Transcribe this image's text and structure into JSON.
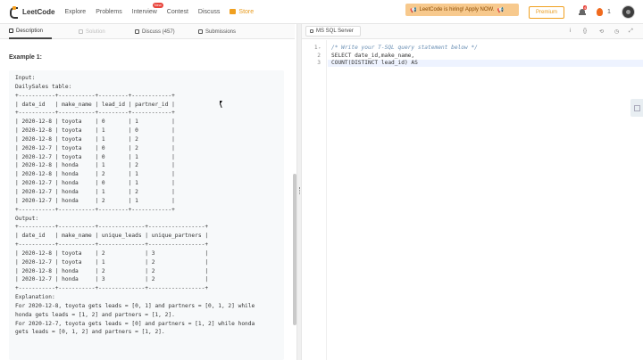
{
  "nav": {
    "logo": "LeetCode",
    "links": [
      "Explore",
      "Problems",
      "Interview",
      "Contest",
      "Discuss"
    ],
    "interview_badge": "New",
    "store": "Store",
    "hiring": "LeetCode is hiring! Apply NOW.",
    "premium": "Premium",
    "notifications": "4",
    "streak": "1"
  },
  "left_tabs": {
    "description": "Description",
    "solution": "Solution",
    "discuss": "Discuss (457)",
    "submissions": "Submissions"
  },
  "description": {
    "example_title": "Example 1:",
    "example_text": "Input:\nDailySales table:\n+-----------+-----------+---------+------------+\n| date_id   | make_name | lead_id | partner_id |\n+-----------+-----------+---------+------------+\n| 2020-12-8 | toyota    | 0       | 1          |\n| 2020-12-8 | toyota    | 1       | 0          |\n| 2020-12-8 | toyota    | 1       | 2          |\n| 2020-12-7 | toyota    | 0       | 2          |\n| 2020-12-7 | toyota    | 0       | 1          |\n| 2020-12-8 | honda     | 1       | 2          |\n| 2020-12-8 | honda     | 2       | 1          |\n| 2020-12-7 | honda     | 0       | 1          |\n| 2020-12-7 | honda     | 1       | 2          |\n| 2020-12-7 | honda     | 2       | 1          |\n+-----------+-----------+---------+------------+\nOutput:\n+-----------+-----------+--------------+-----------------+\n| date_id   | make_name | unique_leads | unique_partners |\n+-----------+-----------+--------------+-----------------+\n| 2020-12-8 | toyota    | 2            | 3               |\n| 2020-12-7 | toyota    | 1            | 2               |\n| 2020-12-8 | honda     | 2            | 2               |\n| 2020-12-7 | honda     | 3            | 2               |\n+-----------+-----------+--------------+-----------------+\nExplanation:\nFor 2020-12-8, toyota gets leads = [0, 1] and partners = [0, 1, 2] while\nhonda gets leads = [1, 2] and partners = [1, 2].\nFor 2020-12-7, toyota gets leads = [0] and partners = [1, 2] while honda\ngets leads = [0, 1, 2] and partners = [1, 2]."
  },
  "editor": {
    "language": "MS SQL Server",
    "line_numbers": [
      "1",
      "2",
      "3"
    ],
    "lines": [
      "/* Write your T-SQL query statement below */",
      "SELECT date_id,make_name,",
      "COUNT(DISTINCT lead_id) AS"
    ],
    "tools": [
      "i",
      "{}",
      "⟲",
      "◷",
      "⤢"
    ]
  }
}
